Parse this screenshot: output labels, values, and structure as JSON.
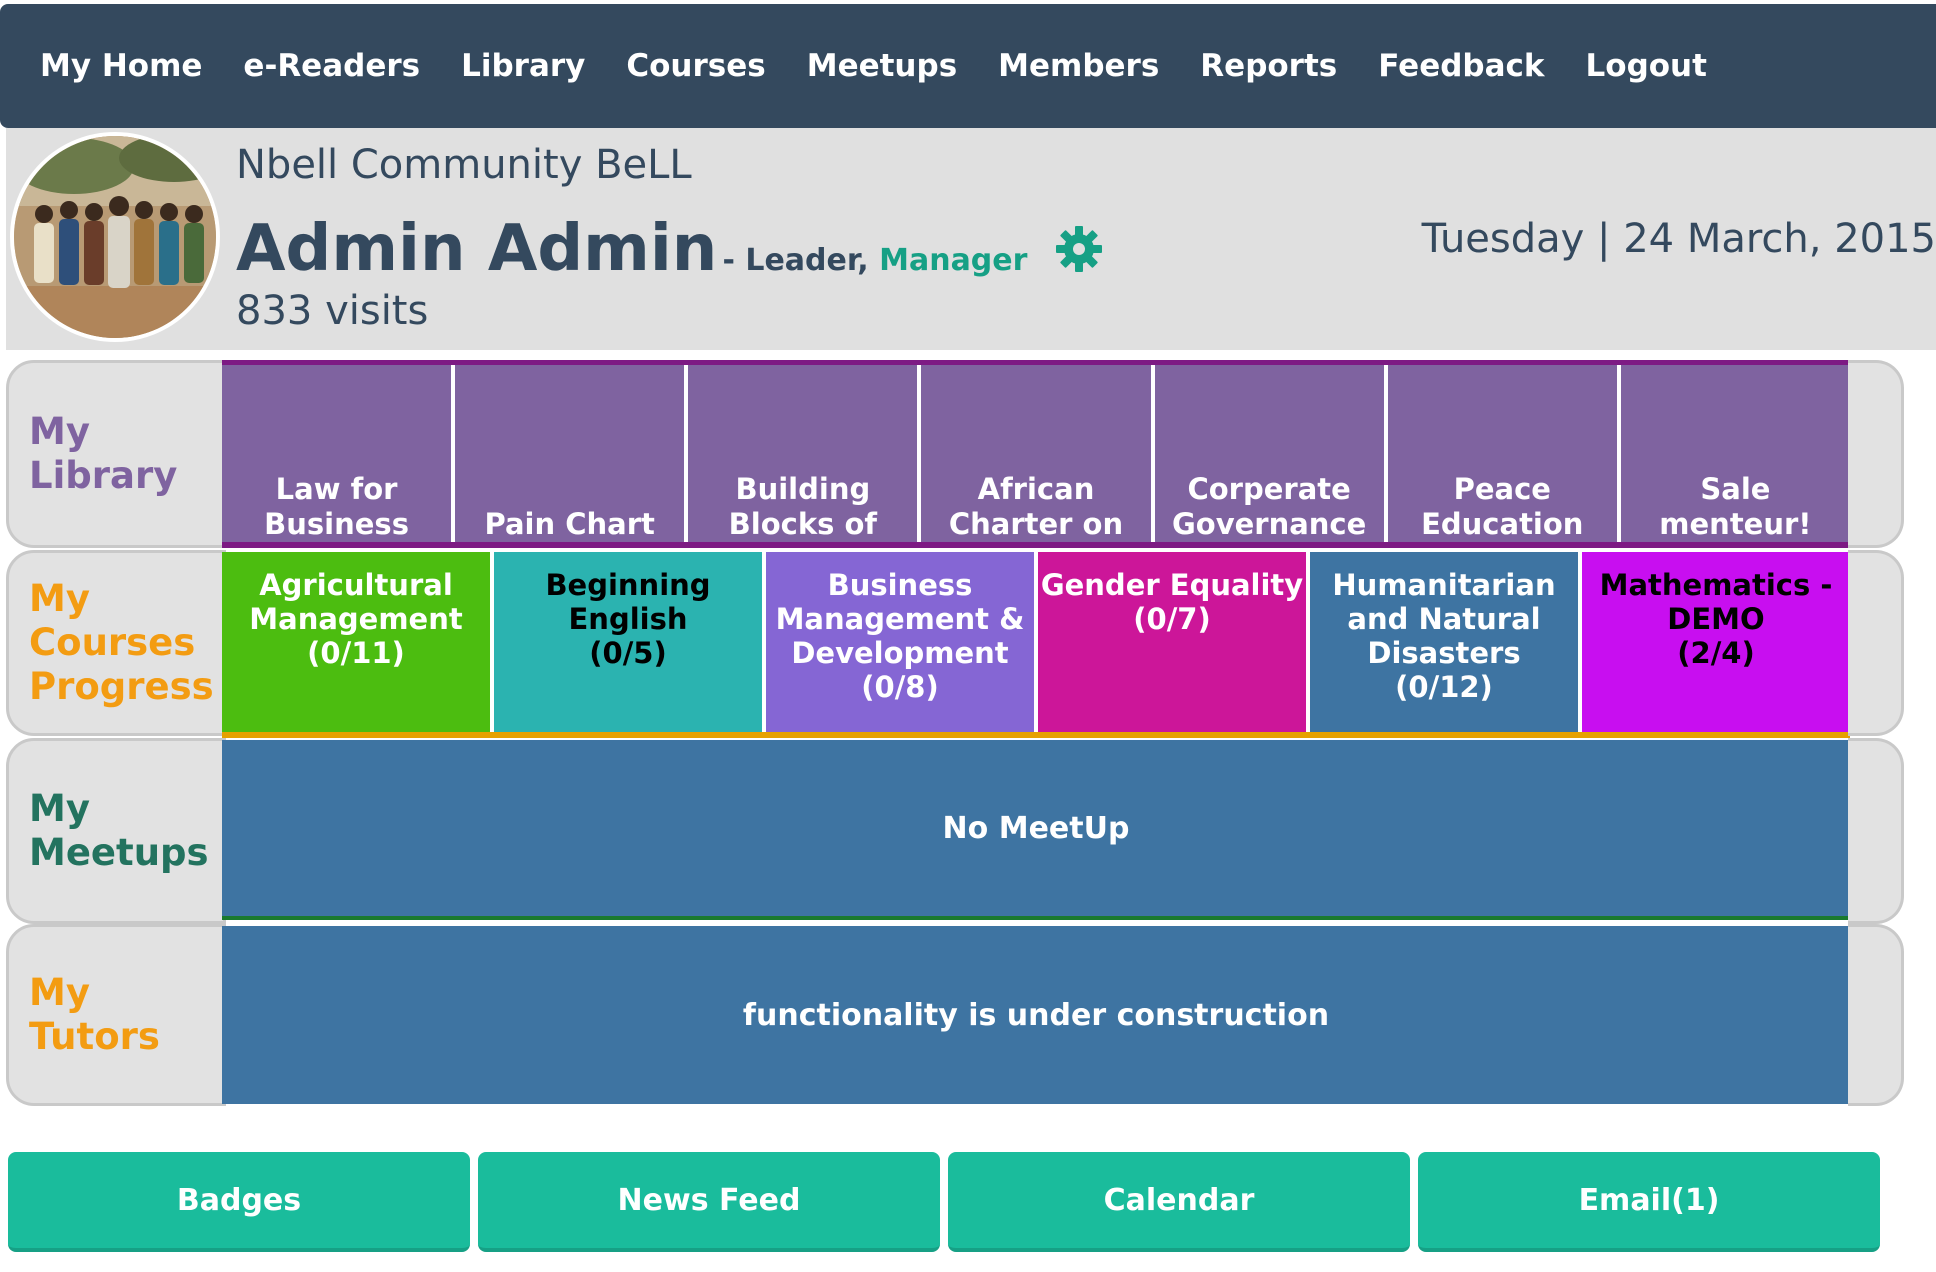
{
  "nav": {
    "items": [
      "My Home",
      "e-Readers",
      "Library",
      "Courses",
      "Meetups",
      "Members",
      "Reports",
      "Feedback",
      "Logout"
    ]
  },
  "profile": {
    "community": "Nbell Community BeLL",
    "name": "Admin Admin",
    "role_prefix": "- Leader,",
    "role_manager": "Manager",
    "visits": "833 visits",
    "date": "Tuesday | 24 March, 2015",
    "settings_icon": "gear-icon"
  },
  "library": {
    "label": "My Library",
    "label_color": "#7f63a0",
    "items": [
      "Law for Business",
      "Pain Chart",
      "Building Blocks of",
      "African Charter on",
      "Corperate Governance",
      "Peace Education",
      "Sale menteur!"
    ]
  },
  "courses": {
    "label": "My Courses Progress",
    "label_color": "#f39c12",
    "items": [
      {
        "title": "Agricultural Management",
        "progress": "(0/11)",
        "bg": "#4cbd10",
        "fg": "#ffffff"
      },
      {
        "title": "Beginning English",
        "progress": "(0/5)",
        "bg": "#2bb3b0",
        "fg": "#000000"
      },
      {
        "title": "Business Management & Development",
        "progress": "(0/8)",
        "bg": "#8566d4",
        "fg": "#ffffff"
      },
      {
        "title": "Gender Equality",
        "progress": "(0/7)",
        "bg": "#cc1699",
        "fg": "#ffffff"
      },
      {
        "title": "Humanitarian and Natural Disasters",
        "progress": "(0/12)",
        "bg": "#3e74a2",
        "fg": "#ffffff"
      },
      {
        "title": "Mathematics - DEMO",
        "progress": "(2/4)",
        "bg": "#c80ef0",
        "fg": "#000000"
      }
    ]
  },
  "meetups": {
    "label": "My Meetups",
    "label_color": "#23735f",
    "text": "No MeetUp"
  },
  "tutors": {
    "label": "My Tutors",
    "label_color": "#f39c12",
    "text": "functionality is under construction"
  },
  "buttons": {
    "badges": "Badges",
    "news_feed": "News Feed",
    "calendar": "Calendar",
    "email": "Email(1)"
  }
}
